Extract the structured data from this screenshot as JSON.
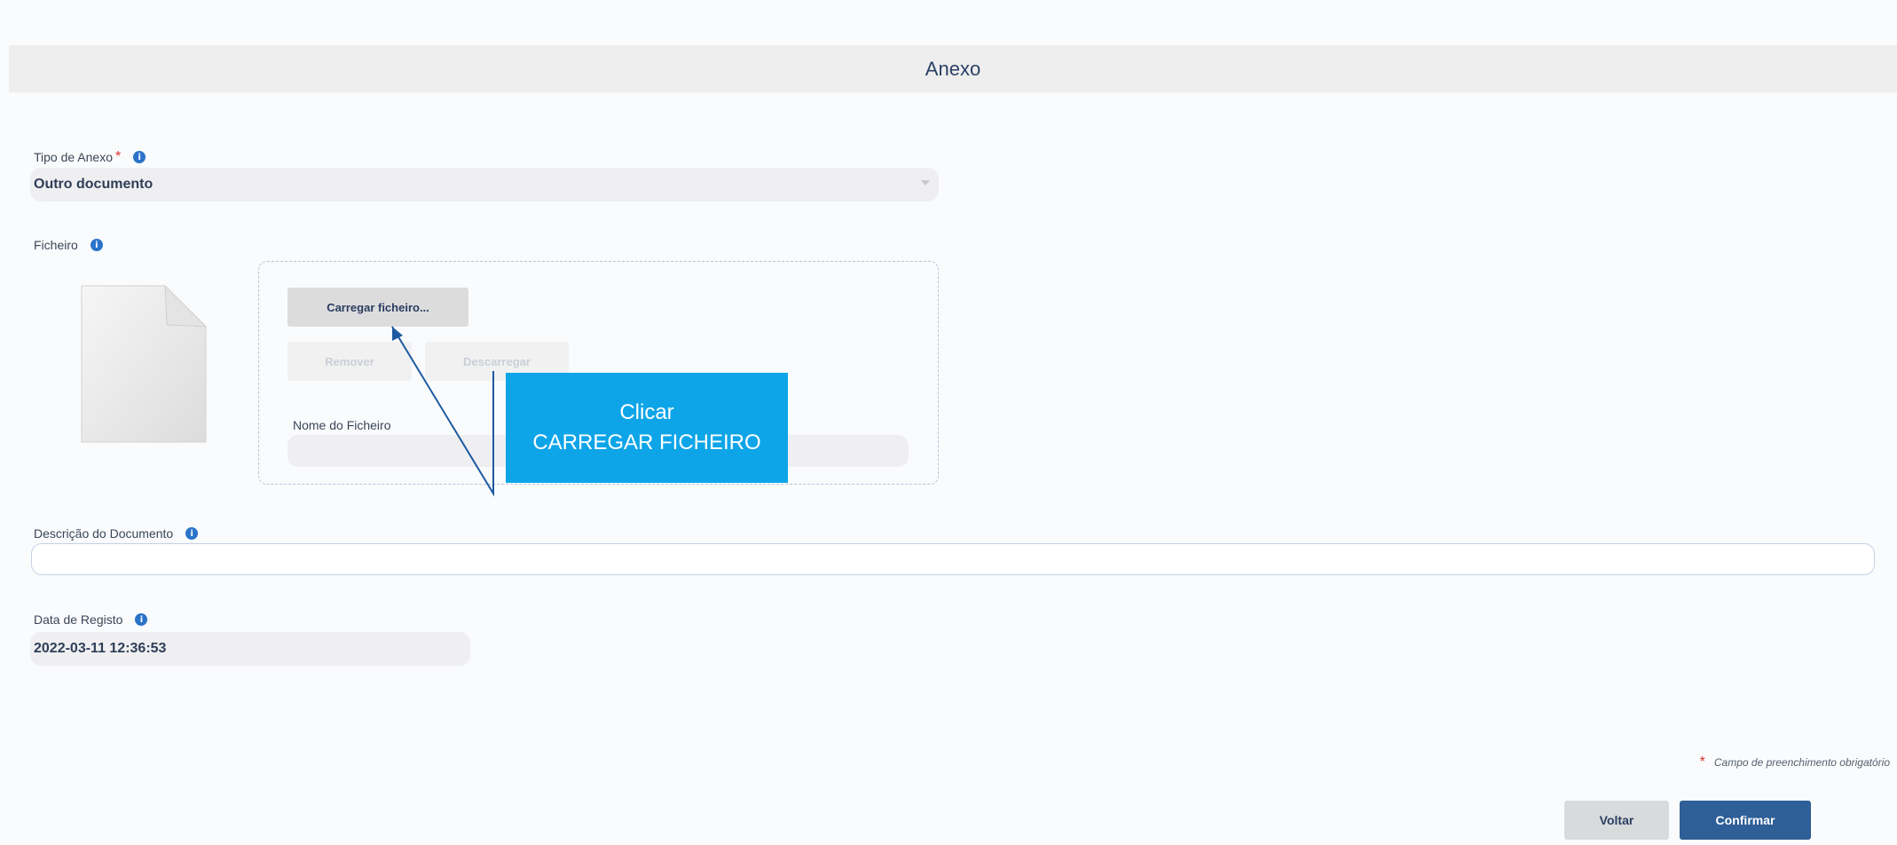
{
  "header": {
    "title": "Anexo"
  },
  "tipo_anexo": {
    "label": "Tipo de Anexo",
    "required_mark": "*",
    "value": "Outro documento"
  },
  "ficheiro": {
    "label": "Ficheiro",
    "load_button": "Carregar ficheiro...",
    "remove_button": "Remover",
    "download_button": "Descarregar",
    "filename_label": "Nome do Ficheiro",
    "filename_value": ""
  },
  "descricao": {
    "label": "Descrição do Documento",
    "value": ""
  },
  "data_registo": {
    "label": "Data de Registo",
    "value": "2022-03-11 12:36:53"
  },
  "callout": {
    "line1": "Clicar",
    "line2": "CARREGAR FICHEIRO"
  },
  "footer": {
    "required_star": "*",
    "required_note": "Campo de preenchimento obrigatório",
    "back_button": "Voltar",
    "confirm_button": "Confirmar"
  },
  "icons": {
    "info": "info-icon",
    "file": "blank-document-icon",
    "dropdown": "chevron-down-icon"
  },
  "colors": {
    "accent": "#2e5f97",
    "callout": "#0ea5e8",
    "required": "#e0312e",
    "info": "#2b73c9"
  }
}
